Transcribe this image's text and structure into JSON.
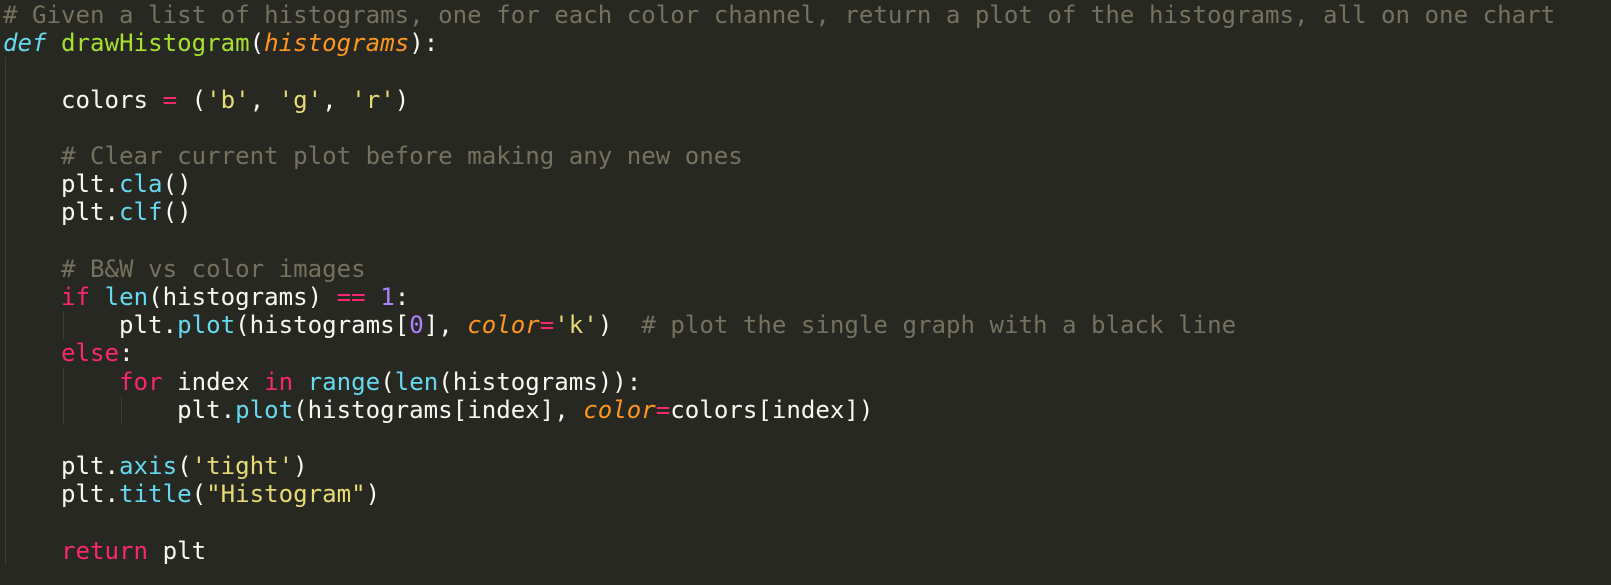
{
  "editor": {
    "theme_colors": {
      "background": "#272822",
      "plain": "#f8f8f2",
      "comment": "#75715e",
      "keyword": "#f92672",
      "storage": "#66d9ef",
      "function": "#a6e22e",
      "parameter": "#fd971f",
      "string": "#e6db74",
      "number": "#ae81ff"
    },
    "lines": [
      {
        "tokens": [
          {
            "t": "comment",
            "s": "# Given a list of histograms, one for each color channel, return a plot of the histograms, all on one chart"
          }
        ]
      },
      {
        "tokens": [
          {
            "t": "storage",
            "s": "def"
          },
          {
            "t": "plain",
            "s": " "
          },
          {
            "t": "func",
            "s": "drawHistogram"
          },
          {
            "t": "plain",
            "s": "("
          },
          {
            "t": "param",
            "s": "histograms"
          },
          {
            "t": "plain",
            "s": "):"
          }
        ]
      },
      {
        "tokens": []
      },
      {
        "tokens": [
          {
            "t": "plain",
            "s": "    colors "
          },
          {
            "t": "keyword",
            "s": "="
          },
          {
            "t": "plain",
            "s": " ("
          },
          {
            "t": "string",
            "s": "'b'"
          },
          {
            "t": "plain",
            "s": ", "
          },
          {
            "t": "string",
            "s": "'g'"
          },
          {
            "t": "plain",
            "s": ", "
          },
          {
            "t": "string",
            "s": "'r'"
          },
          {
            "t": "plain",
            "s": ")"
          }
        ]
      },
      {
        "tokens": []
      },
      {
        "tokens": [
          {
            "t": "plain",
            "s": "    "
          },
          {
            "t": "comment",
            "s": "# Clear current plot before making any new ones"
          }
        ]
      },
      {
        "tokens": [
          {
            "t": "plain",
            "s": "    plt."
          },
          {
            "t": "support",
            "s": "cla"
          },
          {
            "t": "plain",
            "s": "()"
          }
        ]
      },
      {
        "tokens": [
          {
            "t": "plain",
            "s": "    plt."
          },
          {
            "t": "support",
            "s": "clf"
          },
          {
            "t": "plain",
            "s": "()"
          }
        ]
      },
      {
        "tokens": []
      },
      {
        "tokens": [
          {
            "t": "plain",
            "s": "    "
          },
          {
            "t": "comment",
            "s": "# B&W vs color images"
          }
        ]
      },
      {
        "tokens": [
          {
            "t": "plain",
            "s": "    "
          },
          {
            "t": "keyword",
            "s": "if"
          },
          {
            "t": "plain",
            "s": " "
          },
          {
            "t": "support",
            "s": "len"
          },
          {
            "t": "plain",
            "s": "(histograms) "
          },
          {
            "t": "keyword",
            "s": "=="
          },
          {
            "t": "plain",
            "s": " "
          },
          {
            "t": "number",
            "s": "1"
          },
          {
            "t": "plain",
            "s": ":"
          }
        ]
      },
      {
        "tokens": [
          {
            "t": "plain",
            "s": "        plt."
          },
          {
            "t": "support",
            "s": "plot"
          },
          {
            "t": "plain",
            "s": "(histograms["
          },
          {
            "t": "number",
            "s": "0"
          },
          {
            "t": "plain",
            "s": "], "
          },
          {
            "t": "param",
            "s": "color"
          },
          {
            "t": "keyword",
            "s": "="
          },
          {
            "t": "string",
            "s": "'k'"
          },
          {
            "t": "plain",
            "s": ")  "
          },
          {
            "t": "comment",
            "s": "# plot the single graph with a black line"
          }
        ]
      },
      {
        "tokens": [
          {
            "t": "plain",
            "s": "    "
          },
          {
            "t": "keyword",
            "s": "else"
          },
          {
            "t": "plain",
            "s": ":"
          }
        ]
      },
      {
        "tokens": [
          {
            "t": "plain",
            "s": "        "
          },
          {
            "t": "keyword",
            "s": "for"
          },
          {
            "t": "plain",
            "s": " index "
          },
          {
            "t": "keyword",
            "s": "in"
          },
          {
            "t": "plain",
            "s": " "
          },
          {
            "t": "support",
            "s": "range"
          },
          {
            "t": "plain",
            "s": "("
          },
          {
            "t": "support",
            "s": "len"
          },
          {
            "t": "plain",
            "s": "(histograms)):"
          }
        ]
      },
      {
        "tokens": [
          {
            "t": "plain",
            "s": "            plt."
          },
          {
            "t": "support",
            "s": "plot"
          },
          {
            "t": "plain",
            "s": "(histograms[index], "
          },
          {
            "t": "param",
            "s": "color"
          },
          {
            "t": "keyword",
            "s": "="
          },
          {
            "t": "plain",
            "s": "colors[index])"
          }
        ]
      },
      {
        "tokens": []
      },
      {
        "tokens": [
          {
            "t": "plain",
            "s": "    plt."
          },
          {
            "t": "support",
            "s": "axis"
          },
          {
            "t": "plain",
            "s": "("
          },
          {
            "t": "string",
            "s": "'tight'"
          },
          {
            "t": "plain",
            "s": ")"
          }
        ]
      },
      {
        "tokens": [
          {
            "t": "plain",
            "s": "    plt."
          },
          {
            "t": "support",
            "s": "title"
          },
          {
            "t": "plain",
            "s": "("
          },
          {
            "t": "string",
            "s": "\"Histogram\""
          },
          {
            "t": "plain",
            "s": ")"
          }
        ]
      },
      {
        "tokens": []
      },
      {
        "tokens": [
          {
            "t": "plain",
            "s": "    "
          },
          {
            "t": "keyword",
            "s": "return"
          },
          {
            "t": "plain",
            "s": " plt"
          }
        ]
      }
    ]
  }
}
